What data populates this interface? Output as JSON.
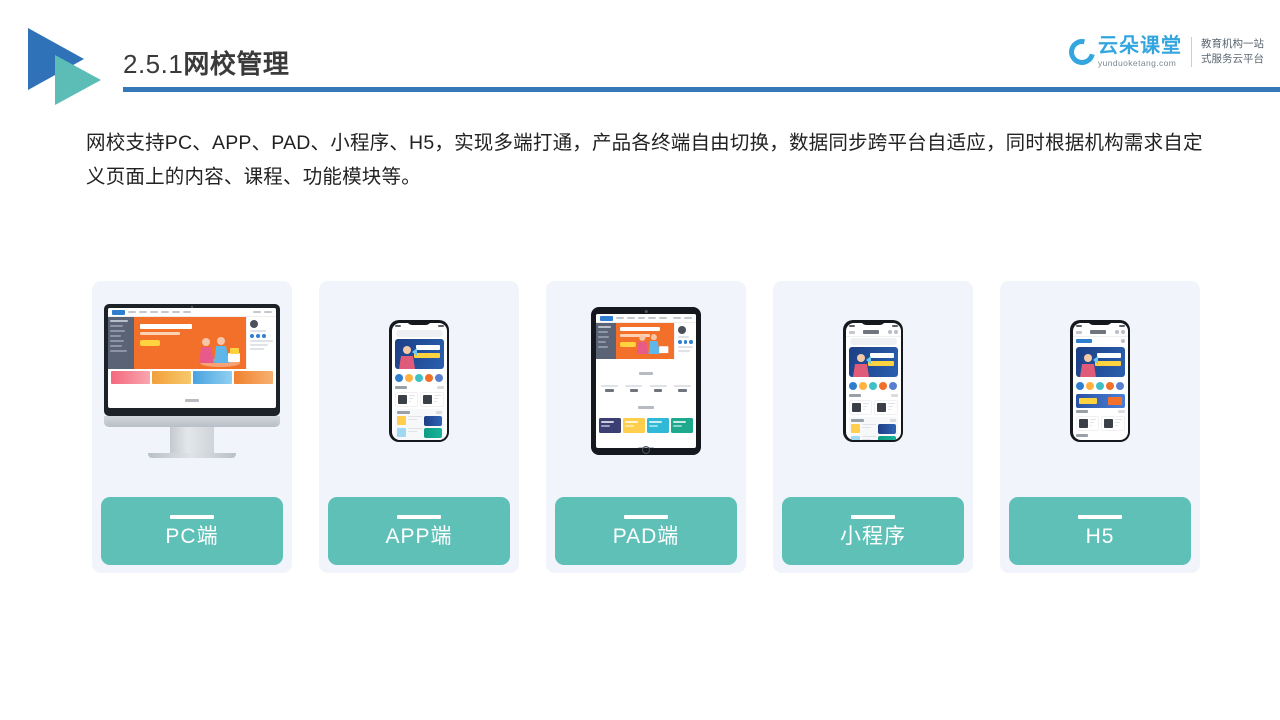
{
  "header": {
    "section_number": "2.5.1",
    "section_title": "网校管理",
    "logo_icon": "double-triangle-play-icon",
    "brand": {
      "name_cn": "云朵课堂",
      "domain": "yunduoketang.com",
      "tagline_line1": "教育机构一站",
      "tagline_line2": "式服务云平台",
      "cloud_icon": "cloud-icon",
      "accent_color": "#34a6df"
    },
    "rule_color": "#3478b8"
  },
  "body": {
    "paragraph": "网校支持PC、APP、PAD、小程序、H5，实现多端打通，产品各终端自由切换，数据同步跨平台自适应，同时根据机构需求自定义页面上的内容、课程、功能模块等。"
  },
  "cards": [
    {
      "label": "PC端",
      "device": "desktop-monitor",
      "device_icon": "imac-icon"
    },
    {
      "label": "APP端",
      "device": "smartphone",
      "device_icon": "phone-icon"
    },
    {
      "label": "PAD端",
      "device": "tablet",
      "device_icon": "tablet-icon"
    },
    {
      "label": "小程序",
      "device": "smartphone",
      "device_icon": "phone-icon"
    },
    {
      "label": "H5",
      "device": "smartphone",
      "device_icon": "phone-icon"
    }
  ],
  "colors": {
    "card_background": "#f1f4fb",
    "label_teal": "#5fc0b8",
    "title_blue": "#3478b8",
    "logo_blue": "#2f72b7",
    "logo_teal": "#5bbdb5",
    "hero_orange": "#f2702a",
    "hero_navy": "#1c3f86"
  }
}
